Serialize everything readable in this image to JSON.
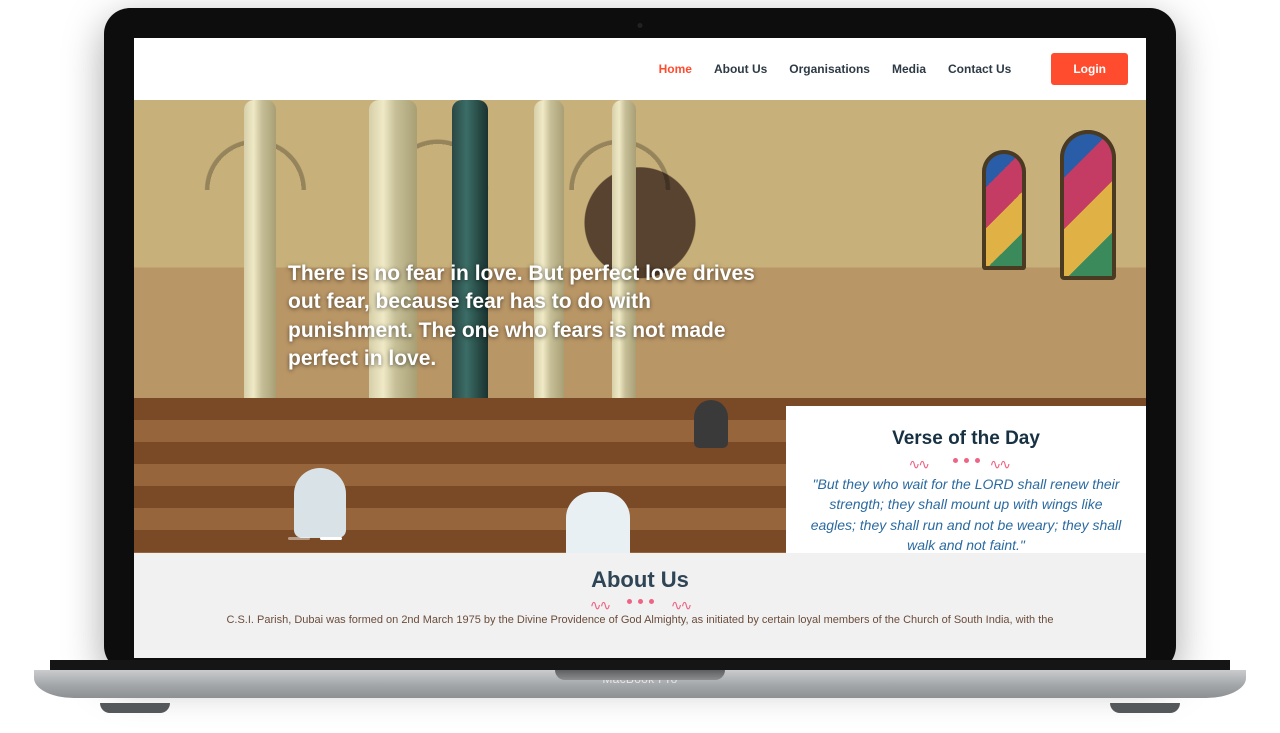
{
  "device_label": "MacBook Pro",
  "nav": {
    "items": [
      {
        "label": "Home",
        "active": true
      },
      {
        "label": "About Us",
        "active": false
      },
      {
        "label": "Organisations",
        "active": false
      },
      {
        "label": "Media",
        "active": false
      },
      {
        "label": "Contact Us",
        "active": false
      }
    ],
    "login_label": "Login"
  },
  "hero": {
    "quote": "There is no fear in love. But perfect love drives out fear, because fear has to do with punishment. The one who fears is not made perfect in love."
  },
  "verse": {
    "heading": "Verse of the Day",
    "text": "\"But they who wait for the LORD shall renew their strength; they shall mount up with wings like eagles; they shall run and not be weary; they shall walk and not faint.\""
  },
  "about": {
    "heading": "About Us",
    "body": "C.S.I. Parish, Dubai was formed on 2nd March 1975 by the Divine Providence of God Almighty, as initiated by certain loyal members of the Church of South India, with the"
  }
}
